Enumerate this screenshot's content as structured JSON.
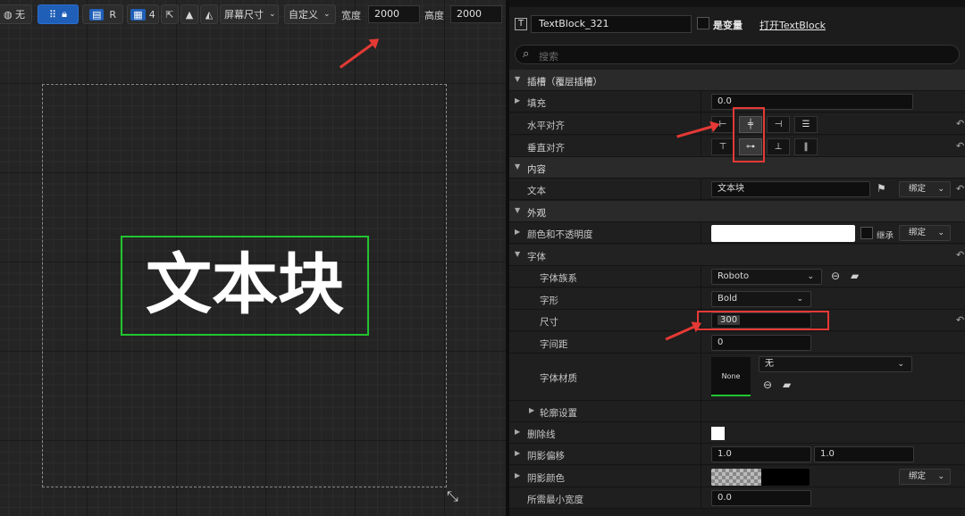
{
  "viewport": {
    "toolbar": {
      "globe_icon": "globe-icon",
      "none_label": "无",
      "r_label": "R",
      "grid_count": "4",
      "screen_size_label": "屏幕尺寸",
      "custom_label": "自定义",
      "width_label": "宽度",
      "width_value": "2000",
      "height_label": "高度",
      "height_value": "2000"
    },
    "text_block_preview": "文本块"
  },
  "details": {
    "widget_name": "TextBlock_321",
    "is_variable_label": "是变量",
    "open_link": "打开TextBlock",
    "search_placeholder": "搜索",
    "slot_category": "插槽（覆层插槽）",
    "padding_label": "填充",
    "padding_value": "0.0",
    "h_align_label": "水平对齐",
    "v_align_label": "垂直对齐",
    "content_category": "内容",
    "text_label": "文本",
    "text_value": "文本块",
    "bind_label": "绑定",
    "appearance_category": "外观",
    "color_label": "颜色和不透明度",
    "inherit_label": "继承",
    "font_label": "字体",
    "font_family_label": "字体族系",
    "font_family_value": "Roboto",
    "typeface_label": "字形",
    "typeface_value": "Bold",
    "size_label": "尺寸",
    "size_value": "300",
    "letter_spacing_label": "字间距",
    "letter_spacing_value": "0",
    "font_material_label": "字体材质",
    "font_material_thumb": "None",
    "font_material_value": "无",
    "outline_label": "轮廓设置",
    "strikethrough_label": "删除线",
    "shadow_offset_label": "阴影偏移",
    "shadow_offset_x": "1.0",
    "shadow_offset_y": "1.0",
    "shadow_color_label": "阴影颜色",
    "min_width_label": "所需最小宽度",
    "min_width_value": "0.0"
  },
  "colors": {
    "selection_green": "#21c52f",
    "annotation_red": "#e53935",
    "toolbar_blue": "#1f5fb8"
  }
}
